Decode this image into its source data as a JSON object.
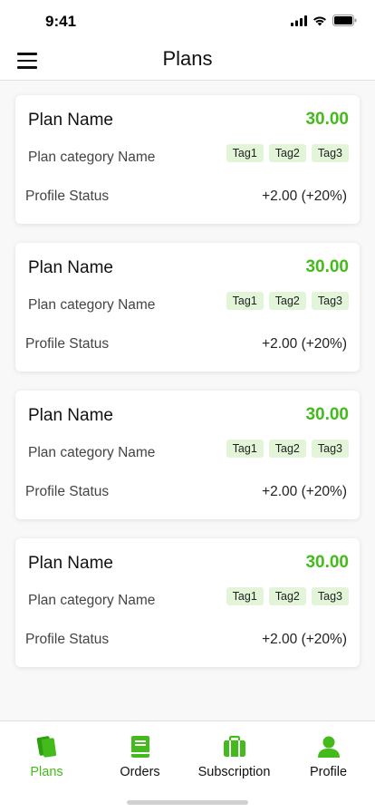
{
  "status_bar": {
    "time": "9:41"
  },
  "header": {
    "title": "Plans"
  },
  "plans": [
    {
      "name": "Plan Name",
      "price": "30.00",
      "category": "Plan category Name",
      "tags": [
        "Tag1",
        "Tag2",
        "Tag3"
      ],
      "status_label": "Profile Status",
      "status_value": "+2.00 (+20%)"
    },
    {
      "name": "Plan Name",
      "price": "30.00",
      "category": "Plan category Name",
      "tags": [
        "Tag1",
        "Tag2",
        "Tag3"
      ],
      "status_label": "Profile Status",
      "status_value": "+2.00 (+20%)"
    },
    {
      "name": "Plan Name",
      "price": "30.00",
      "category": "Plan category Name",
      "tags": [
        "Tag1",
        "Tag2",
        "Tag3"
      ],
      "status_label": "Profile Status",
      "status_value": "+2.00 (+20%)"
    },
    {
      "name": "Plan Name",
      "price": "30.00",
      "category": "Plan category Name",
      "tags": [
        "Tag1",
        "Tag2",
        "Tag3"
      ],
      "status_label": "Profile Status",
      "status_value": "+2.00 (+20%)"
    }
  ],
  "tab_bar": {
    "active": "plans",
    "tabs": [
      {
        "label": "Plans",
        "icon": "cards-icon"
      },
      {
        "label": "Orders",
        "icon": "book-icon"
      },
      {
        "label": "Subscription",
        "icon": "briefcase-icon"
      },
      {
        "label": "Profile",
        "icon": "person-icon"
      }
    ]
  },
  "colors": {
    "accent": "#44bb1c",
    "tag_bg": "#e2f5d8",
    "text": "#111111"
  }
}
